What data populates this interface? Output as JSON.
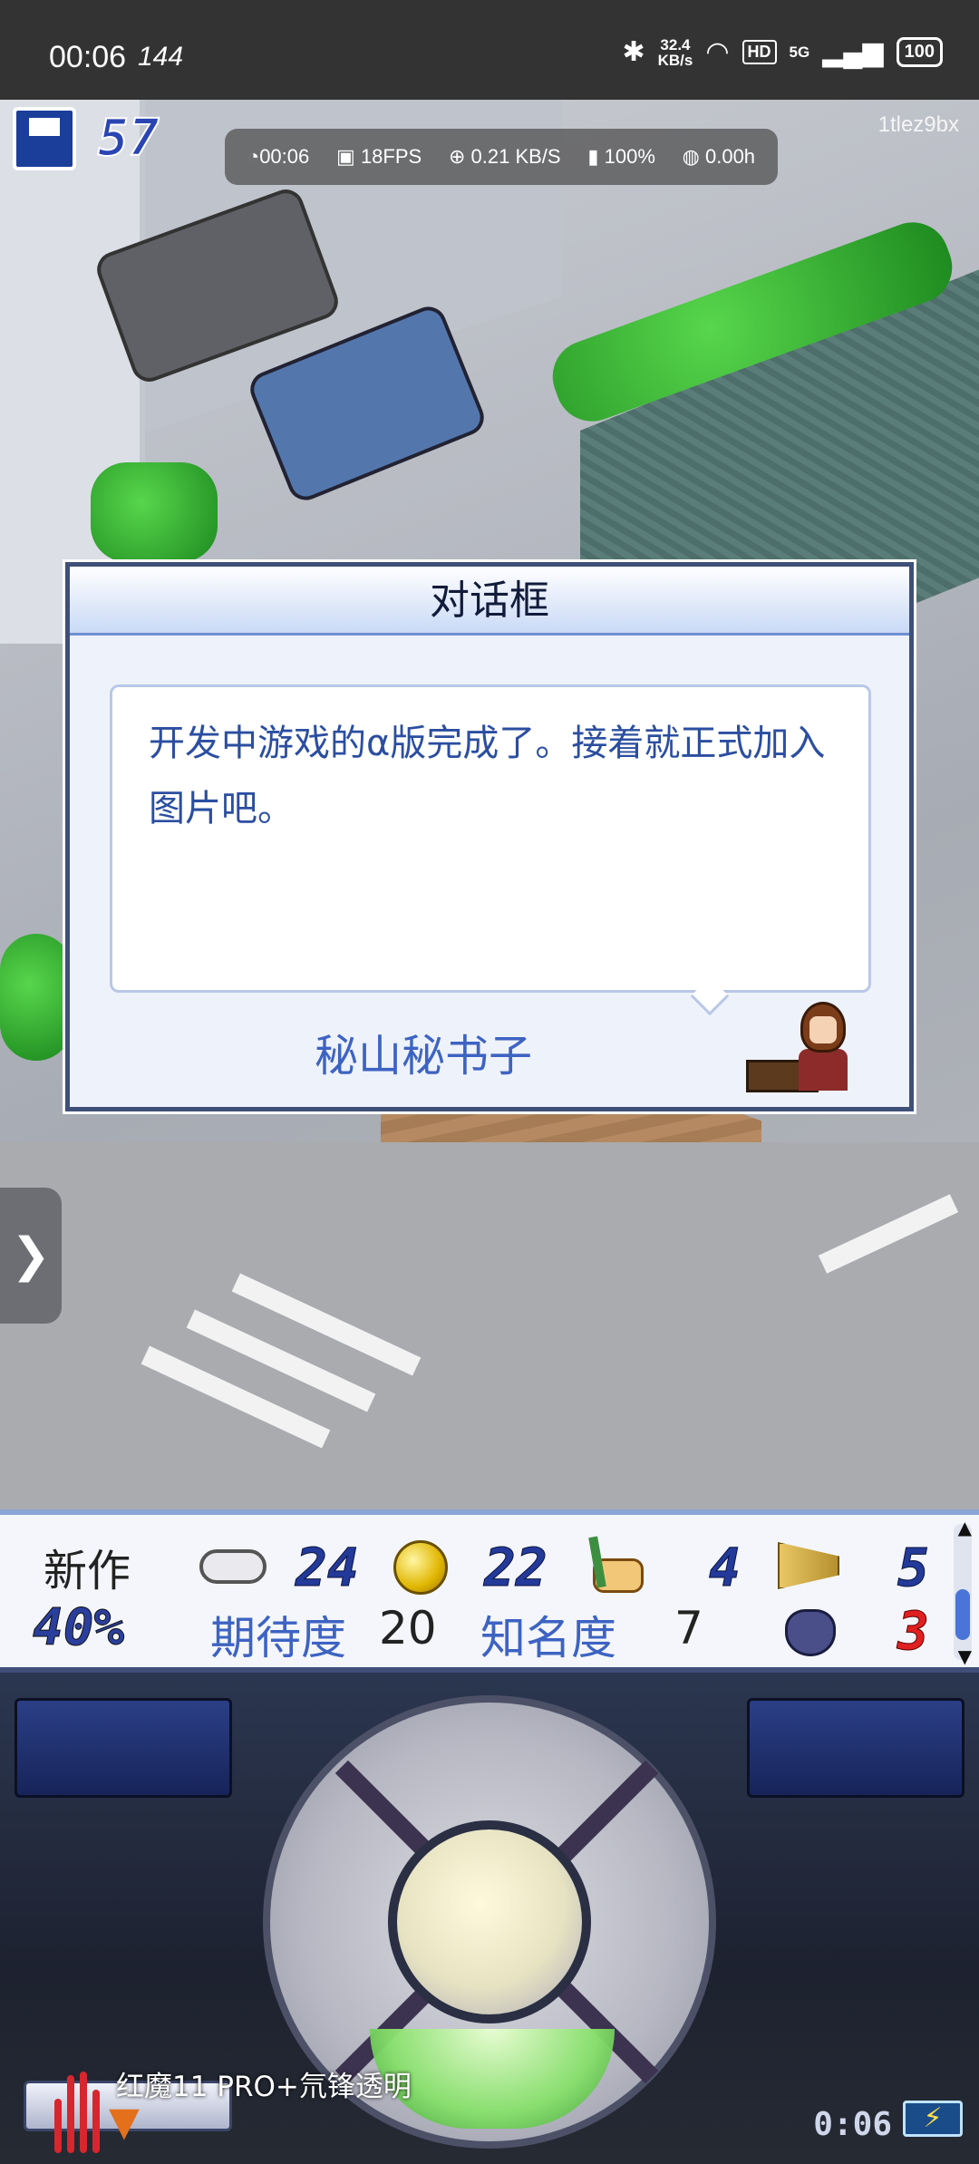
{
  "status_bar": {
    "time": "00:06",
    "refresh_rate": "144",
    "net_speed_value": "32.4",
    "net_speed_unit": "KB/s",
    "hd_badge": "HD",
    "signal": "5G",
    "battery": "100"
  },
  "hud": {
    "save_count": "57",
    "user_id": "1tlez9bx",
    "perf": {
      "time": "00:06",
      "fps": "18FPS",
      "net": "0.21 KB/S",
      "battery": "100%",
      "hours": "0.00h"
    }
  },
  "dialog": {
    "title": "对话框",
    "message": "开发中游戏的α版完成了。接着就正式加入图片吧。",
    "speaker": "秘山秘书子"
  },
  "stats": {
    "new_label": "新作",
    "progress": "40%",
    "fun": "24",
    "creativity": "22",
    "graphics": "4",
    "sound": "5",
    "bugs": "3",
    "expectation_label": "期待度",
    "expectation_value": "20",
    "fame_label": "知名度",
    "fame_value": "7"
  },
  "controller": {
    "clock": "0:06"
  },
  "overlay": {
    "text": "红魔11 PRO+氘锋透明"
  },
  "icons": {
    "fun": "gamepad-icon",
    "creativity": "coin-icon",
    "graphics": "paint-palette-icon",
    "sound": "trumpet-icon",
    "bugs": "bug-icon"
  },
  "colors": {
    "accent_blue": "#3d63c2",
    "stat_number": "#233a9a",
    "bug_red": "#e02020"
  }
}
